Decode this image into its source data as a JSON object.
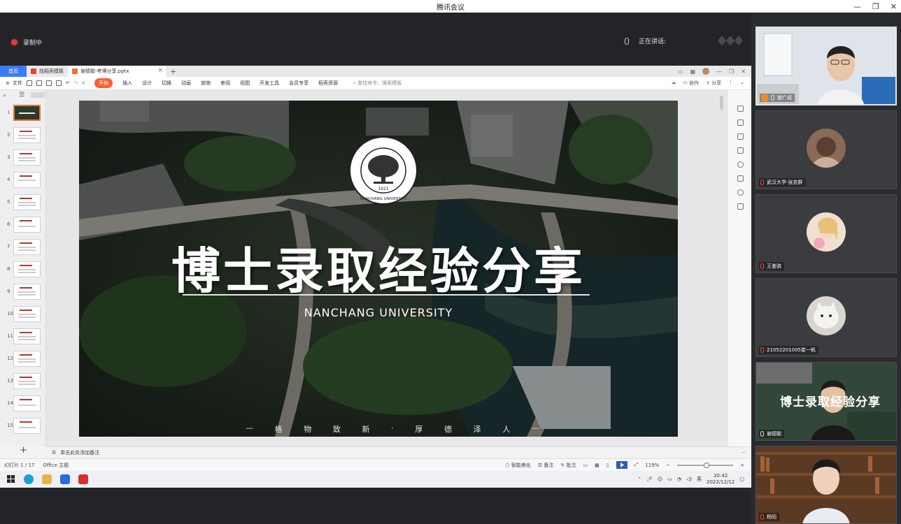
{
  "window": {
    "title": "腾讯会议",
    "minimize": "—",
    "restore": "❐",
    "close": "✕"
  },
  "meeting": {
    "recording_label": "录制中",
    "speaking_label": "正在讲话:"
  },
  "wps": {
    "tabs": {
      "home": "首页",
      "template": "找稻壳模板",
      "doc": "谢德聪-考博分享.pptx",
      "new": "+"
    },
    "menu": {
      "file": "文件",
      "items": [
        "开始",
        "插入",
        "设计",
        "切换",
        "动画",
        "放映",
        "审阅",
        "视图",
        "开发工具",
        "会员专享",
        "稻壳资源"
      ],
      "search": "查找命令、搜索模板",
      "collab": "协作",
      "share": "分享"
    },
    "slide_numbers": [
      "1",
      "2",
      "3",
      "4",
      "5",
      "6",
      "7",
      "8",
      "9",
      "10",
      "11",
      "12",
      "13",
      "14",
      "15"
    ],
    "slide": {
      "seal_text": "NANCHANG UNIVERSITY",
      "seal_year": "1921",
      "title": "博士录取经验分享",
      "subtitle": "NANCHANG UNIVERSITY",
      "motto": [
        "—",
        "格",
        "物",
        "致",
        "新",
        "·",
        "厚",
        "德",
        "泽",
        "人",
        "—"
      ]
    },
    "notes_placeholder": "单击此处添加备注",
    "status": {
      "slide_counter": "幻灯片 1 / 17",
      "theme": "Office 主题",
      "smart": "智能美化",
      "notes": "备注",
      "comments": "批注",
      "zoom": "119%"
    }
  },
  "taskbar": {
    "ime": "英",
    "time": "20:42",
    "date": "2022/12/12"
  },
  "participants": [
    {
      "name": "谢广成",
      "is_host": true
    },
    {
      "name": "武汉大学-张克群"
    },
    {
      "name": "王鉴骁"
    },
    {
      "name": "21052201005崔一帆"
    },
    {
      "name": "谢德聪",
      "video_overlay": "博士录取经验分享"
    },
    {
      "name": "杨阳"
    }
  ],
  "colors": {
    "accent": "#3d7bf6",
    "wps_orange": "#ff5c35",
    "record_red": "#e03b3b"
  }
}
